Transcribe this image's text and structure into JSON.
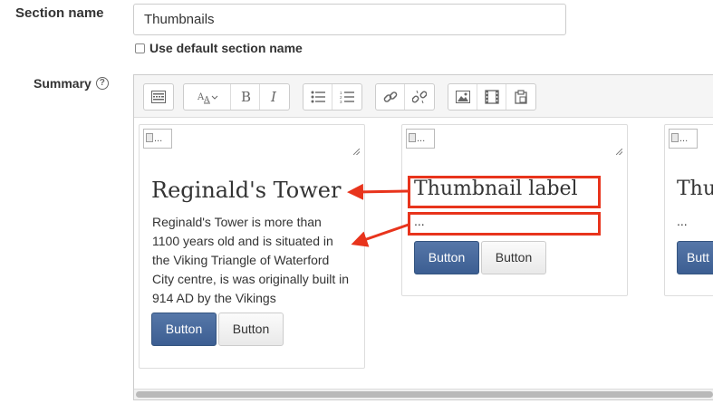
{
  "form": {
    "section_name_label": "Section name",
    "section_name_value": "Thumbnails",
    "default_name_checkbox_label": "Use default section name",
    "summary_label": "Summary"
  },
  "toolbar": {
    "icons": [
      "toolbar-toggle-icon",
      "text-style-icon",
      "bold-icon",
      "italic-icon",
      "unordered-list-icon",
      "ordered-list-icon",
      "link-icon",
      "unlink-icon",
      "image-icon",
      "media-icon",
      "paste-icon"
    ]
  },
  "cards": [
    {
      "img_alt": "...",
      "title": "Reginald's Tower",
      "text": "Reginald's Tower is more than 1100 years old and is situated in the Viking Triangle of Waterford City centre, is was originally built in 914 AD by the Vikings",
      "primary_button": "Button",
      "default_button": "Button"
    },
    {
      "img_alt": "...",
      "title": "Thumbnail label",
      "text": "...",
      "primary_button": "Button",
      "default_button": "Button"
    },
    {
      "img_alt": "...",
      "title": "Thu",
      "text": "...",
      "primary_button": "Butt"
    }
  ],
  "colors": {
    "annotation_red": "#e8341c",
    "primary_button": "#3c5e92"
  }
}
